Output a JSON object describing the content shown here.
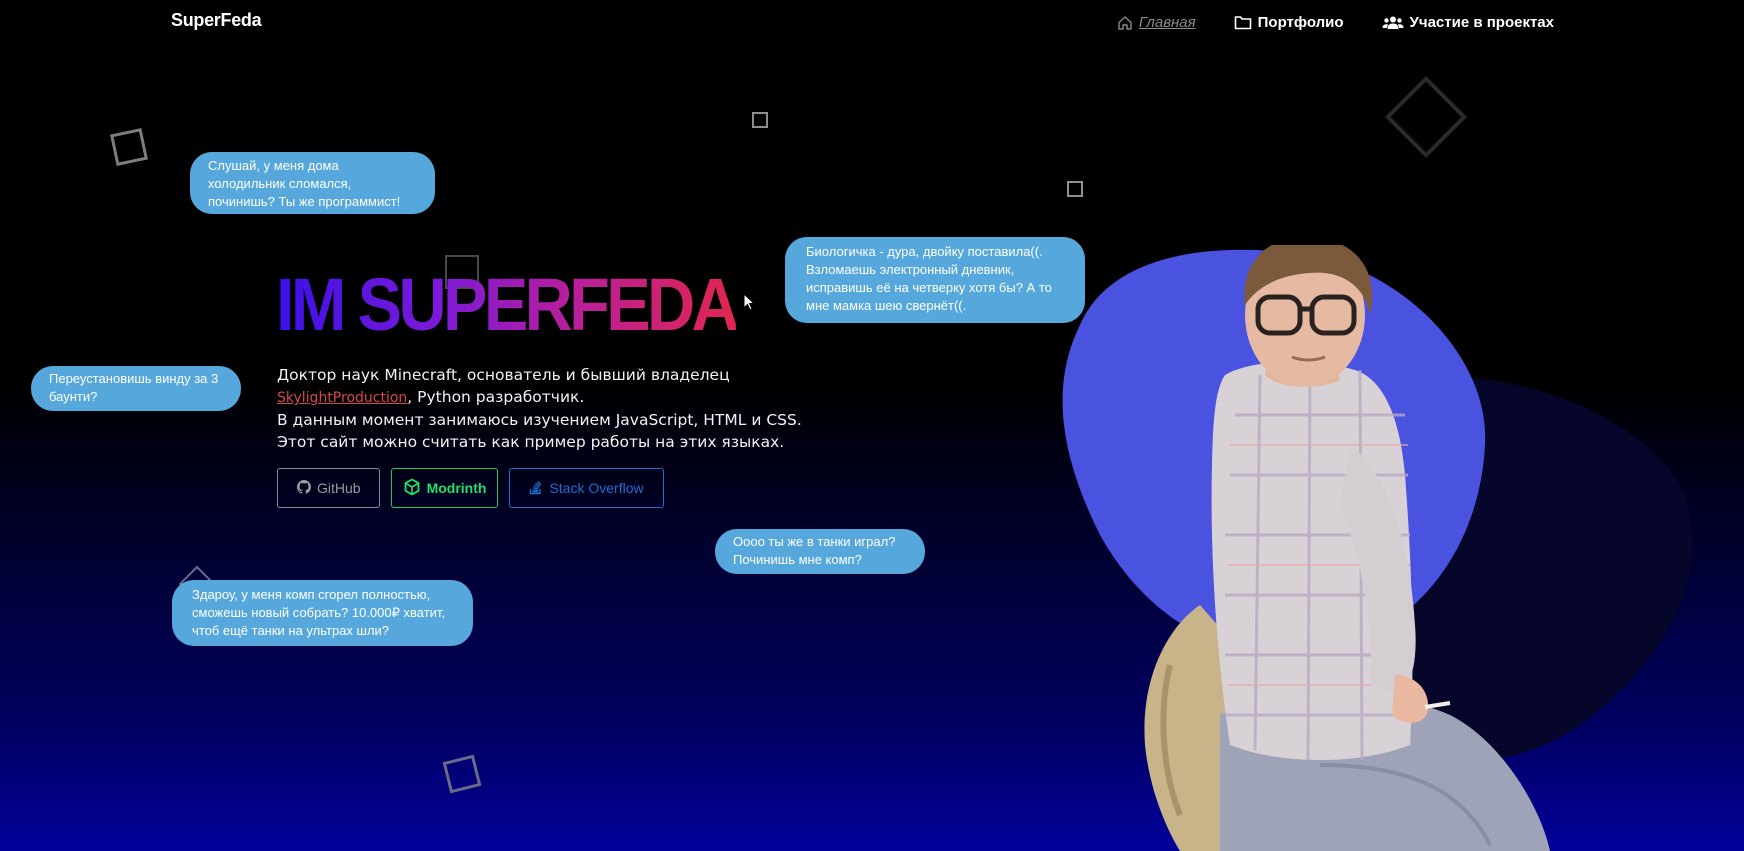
{
  "header": {
    "brand": "SuperFeda",
    "nav": [
      {
        "label": "Главная",
        "icon": "home-icon",
        "active": true
      },
      {
        "label": "Портфолио",
        "icon": "folder-icon",
        "active": false
      },
      {
        "label": "Участие в проектах",
        "icon": "users-icon",
        "active": false
      }
    ]
  },
  "hero": {
    "title": "IM SUPERFEDA",
    "line1": "Доктор наук Minecraft, основатель и бывший владелец",
    "link": "SkylightProduction",
    "line2_suffix": ", Python разработчик.",
    "line3": "В данным момент занимаюсь изучением JavaScript, HTML и CSS. Этот сайт можно считать как пример работы на этих языках."
  },
  "buttons": {
    "github": {
      "label": "GitHub",
      "icon": "github-icon"
    },
    "modrinth": {
      "label": "Modrinth",
      "icon": "modrinth-icon"
    },
    "stackoverflow": {
      "label": "Stack Overflow",
      "icon": "stackoverflow-icon"
    }
  },
  "bubbles": {
    "fridge": "Слушай, у меня дома холодильник сломался, починишь? Ты же программист!",
    "diary": "Биологичка - дура, двойку поставила((. Взломаешь электронный дневник, исправишь её на четверку хотя бы? А то мне мамка шею свернёт((.",
    "windows": "Переустановишь винду за 3 баунти?",
    "tanks": "Оооо ты же в танки играл? Починишь мне комп?",
    "pc": "Здароу, у меня комп сгорел полностью, сможешь новый собрать? 10.000₽ хватит, чтоб ещё танки на ультрах шли?"
  },
  "colors": {
    "bubble": "#56a8dc",
    "blob": "#4a52e0",
    "github": "#8a8a8a",
    "modrinth": "#22c55e",
    "stackoverflow": "#1d6fd0",
    "link": "#d44a4a"
  }
}
